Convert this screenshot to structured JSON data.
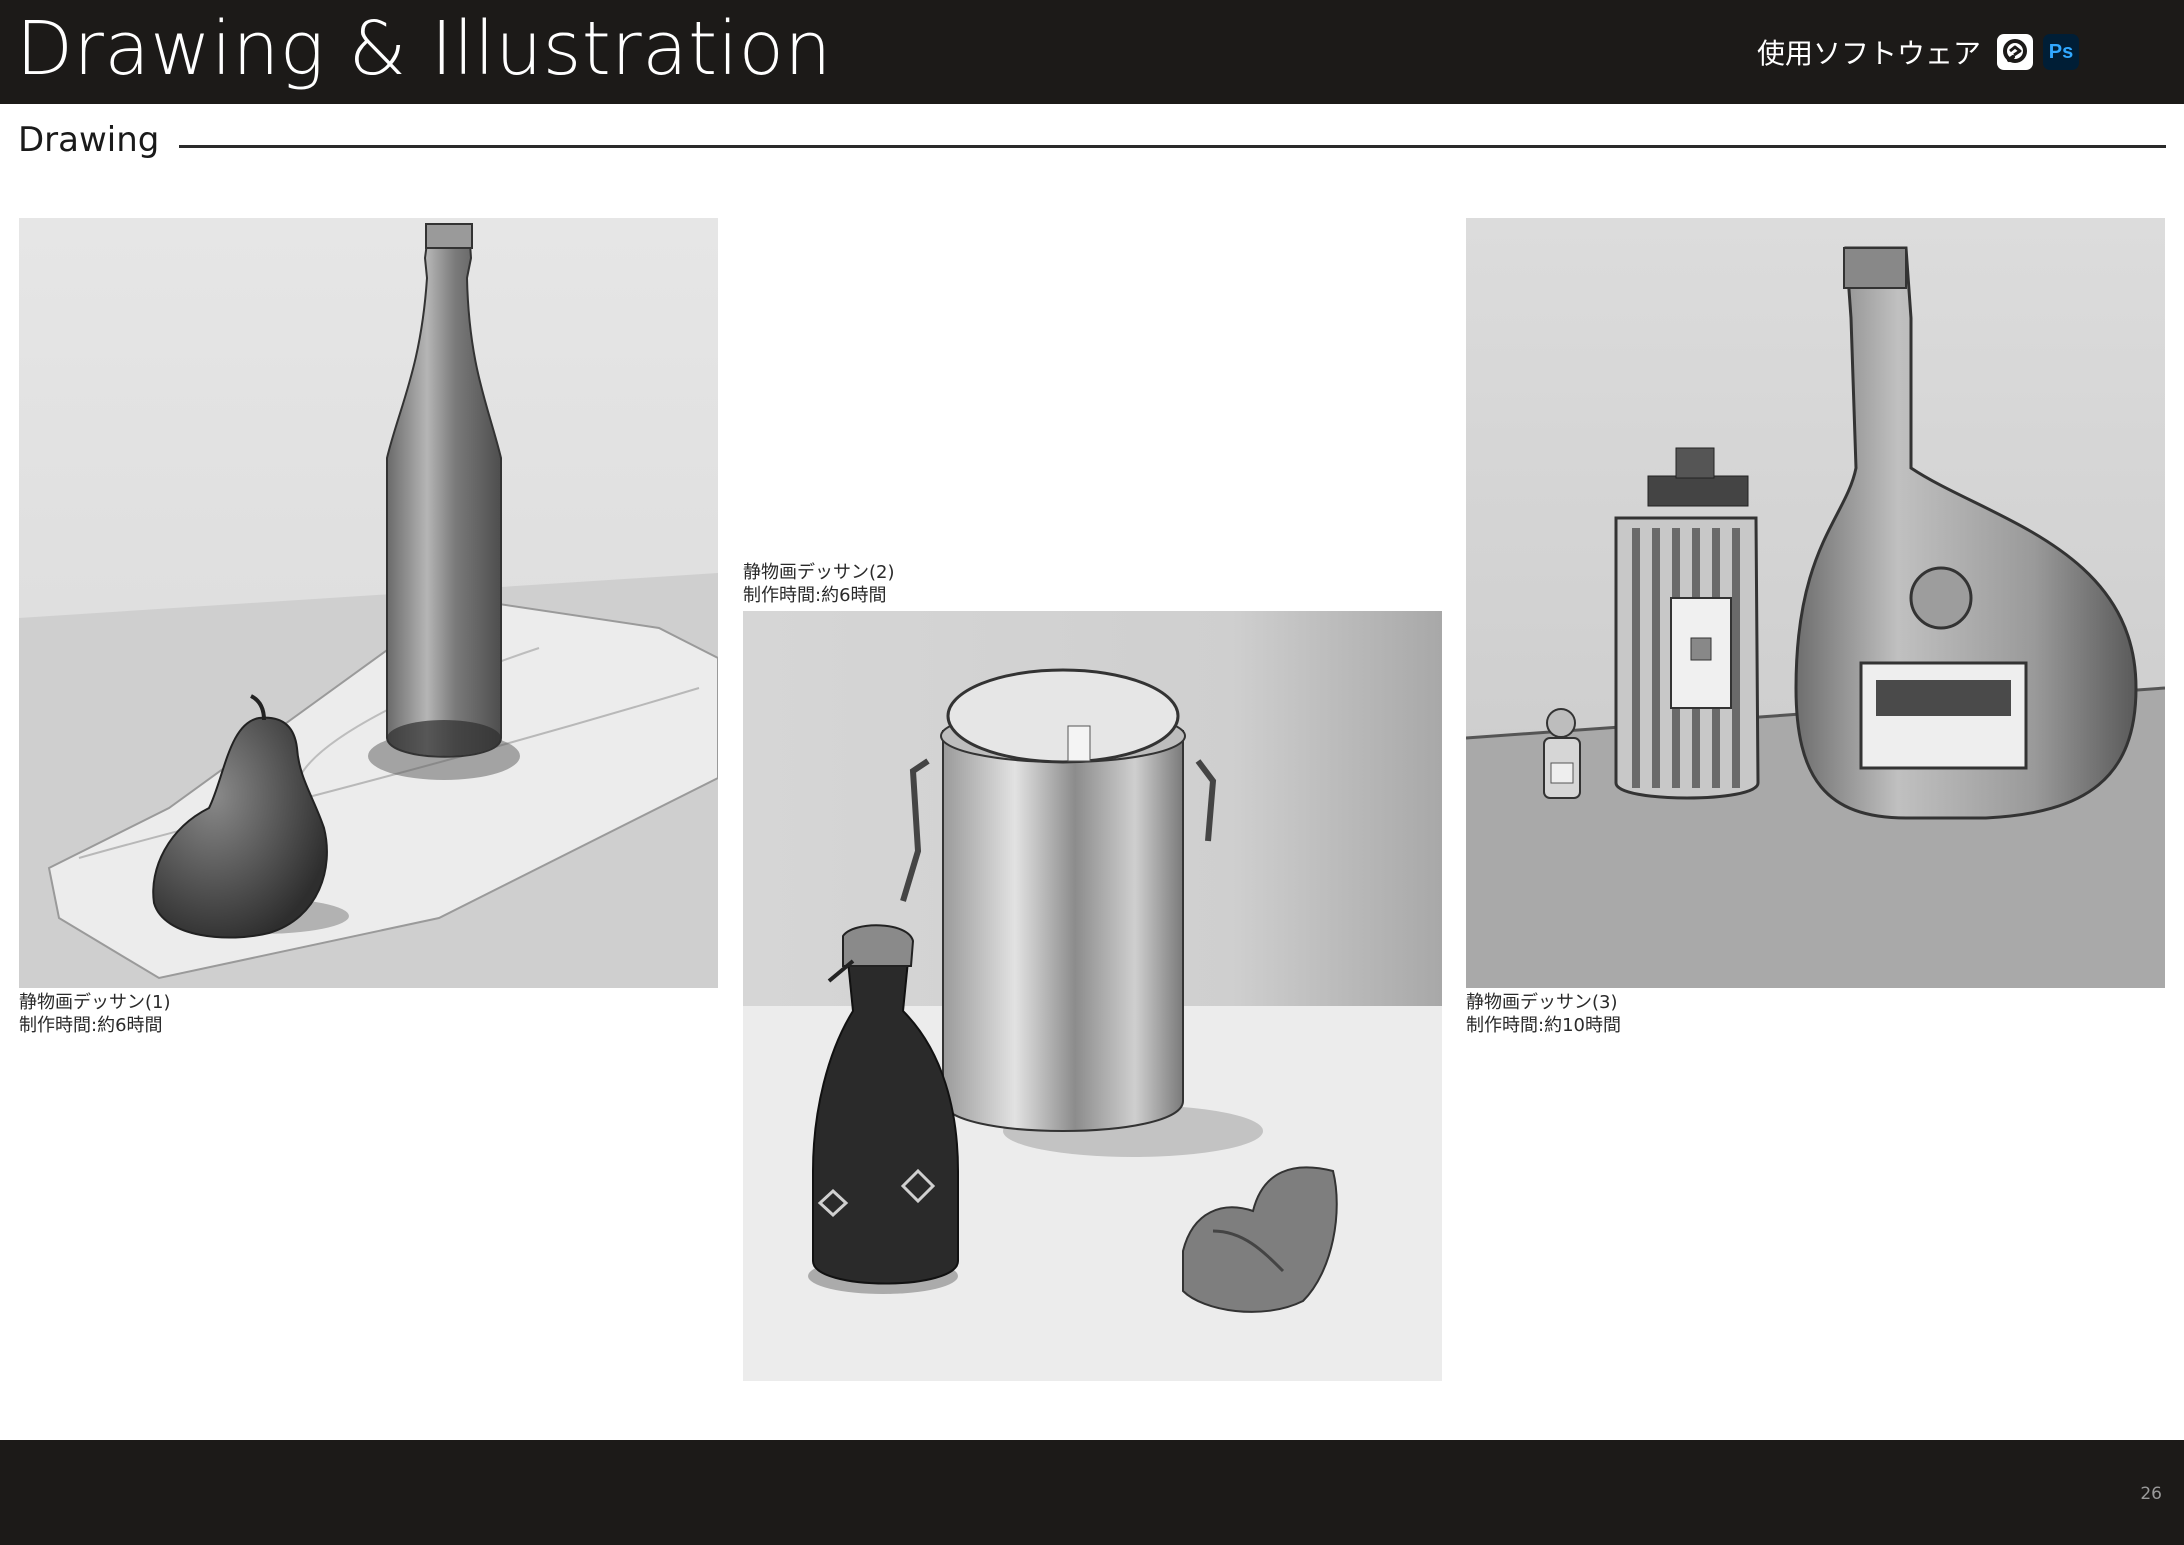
{
  "header": {
    "title": "Drawing & Illustration",
    "software_label": "使用ソフトウェア",
    "software_icons": [
      {
        "icon": "clip-studio-icon"
      },
      {
        "icon": "photoshop-icon",
        "label": "Ps"
      }
    ]
  },
  "section": {
    "title": "Drawing"
  },
  "artworks": [
    {
      "caption_title": "静物画デッサン(1)",
      "caption_time": "制作時間:約6時間"
    },
    {
      "caption_title": "静物画デッサン(2)",
      "caption_time": "制作時間:約6時間"
    },
    {
      "caption_title": "静物画デッサン(3)",
      "caption_time": "制作時間:約10時間"
    }
  ],
  "footer": {
    "page_number": "26"
  }
}
